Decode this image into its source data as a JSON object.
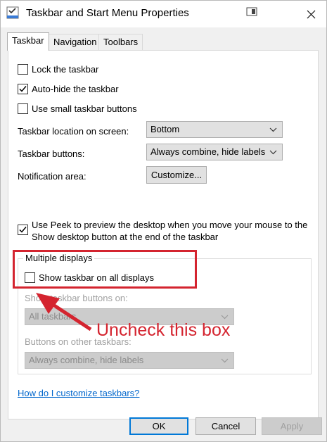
{
  "window": {
    "title": "Taskbar and Start Menu Properties"
  },
  "tabs": [
    {
      "label": "Taskbar",
      "active": true
    },
    {
      "label": "Navigation",
      "active": false
    },
    {
      "label": "Toolbars",
      "active": false
    }
  ],
  "taskbar": {
    "lock_label": "Lock the taskbar",
    "lock_checked": false,
    "autohide_label": "Auto-hide the taskbar",
    "autohide_checked": true,
    "small_buttons_label": "Use small taskbar buttons",
    "small_buttons_checked": false,
    "location_label": "Taskbar location on screen:",
    "location_value": "Bottom",
    "buttons_label": "Taskbar buttons:",
    "buttons_value": "Always combine, hide labels",
    "notification_label": "Notification area:",
    "customize_button": "Customize...",
    "peek_line1": "Use Peek to preview the desktop when you move your mouse to the",
    "peek_line2": "Show desktop button at the end of the taskbar",
    "peek_checked": true
  },
  "multiple_displays": {
    "group_title": "Multiple displays",
    "show_all_label": "Show taskbar on all displays",
    "show_all_checked": false,
    "show_buttons_on_label": "Show taskbar buttons on:",
    "show_buttons_on_value": "All taskbars",
    "other_taskbars_label": "Buttons on other taskbars:",
    "other_taskbars_value": "Always combine, hide labels"
  },
  "help_link": "How do I customize taskbars?",
  "footer": {
    "ok": "OK",
    "cancel": "Cancel",
    "apply": "Apply"
  },
  "annotation": {
    "text": "Uncheck this box",
    "color": "#d4242f"
  },
  "colors": {
    "accent": "#0078d7",
    "link": "#0066cc",
    "annotation": "#d4242f"
  },
  "icons": [
    "taskbar-app-icon",
    "help-window-icon",
    "close-icon",
    "checkmark-icon",
    "chevron-down-icon",
    "arrow-annotation-icon"
  ]
}
